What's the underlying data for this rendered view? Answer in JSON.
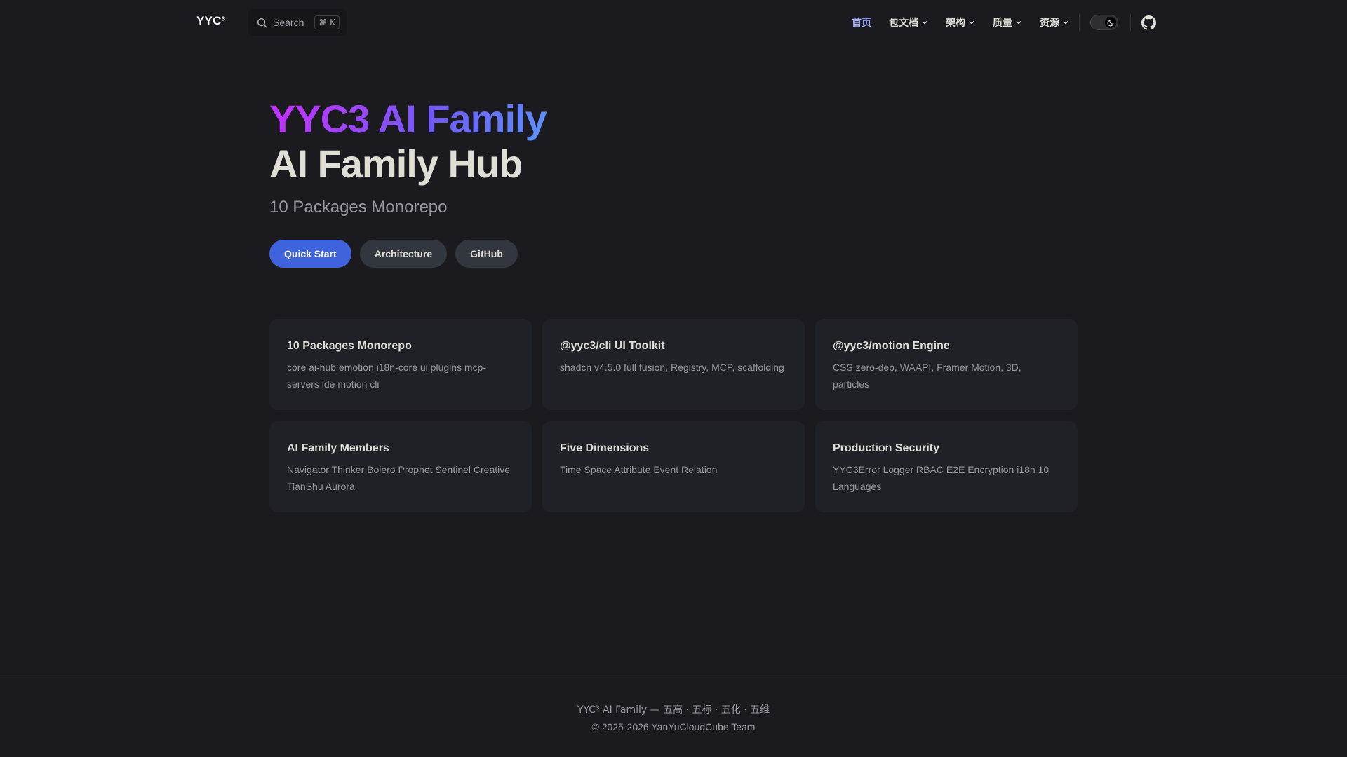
{
  "nav": {
    "logo": "YYC³",
    "search": {
      "label": "Search",
      "shortcut": "⌘ K"
    },
    "items": [
      {
        "label": "首页",
        "active": true
      },
      {
        "label": "包文档",
        "dropdown": true
      },
      {
        "label": "架构",
        "dropdown": true
      },
      {
        "label": "质量",
        "dropdown": true
      },
      {
        "label": "资源",
        "dropdown": true
      }
    ],
    "icons": [
      "search-icon",
      "chevron-down-icon",
      "moon-icon",
      "github-icon"
    ]
  },
  "hero": {
    "name": "YYC3 AI Family",
    "text": "AI Family Hub",
    "tagline": "10 Packages Monorepo",
    "actions": [
      {
        "label": "Quick Start",
        "theme": "brand"
      },
      {
        "label": "Architecture",
        "theme": "alt"
      },
      {
        "label": "GitHub",
        "theme": "alt"
      }
    ]
  },
  "features": [
    {
      "title": "10 Packages Monorepo",
      "details": "core ai-hub emotion i18n-core ui plugins mcp-servers ide motion cli"
    },
    {
      "title": "@yyc3/cli UI Toolkit",
      "details": "shadcn v4.5.0 full fusion, Registry, MCP, scaffolding"
    },
    {
      "title": "@yyc3/motion Engine",
      "details": "CSS zero-dep, WAAPI, Framer Motion, 3D, particles"
    },
    {
      "title": "AI Family Members",
      "details": "Navigator Thinker Bolero Prophet Sentinel Creative TianShu Aurora"
    },
    {
      "title": "Five Dimensions",
      "details": "Time Space Attribute Event Relation"
    },
    {
      "title": "Production Security",
      "details": "YYC3Error Logger RBAC E2E Encryption i18n 10 Languages"
    }
  ],
  "footer": {
    "message": "YYC³ AI Family — 五高 · 五标 · 五化 · 五维",
    "copyright": "© 2025-2026 YanYuCloudCube Team"
  },
  "colors": {
    "background": "#1b1b1f",
    "card": "#202127",
    "brand": "#3e63dd",
    "active_link": "#a8b1ff",
    "text": "#dfdfd6",
    "muted": "#98989f"
  }
}
